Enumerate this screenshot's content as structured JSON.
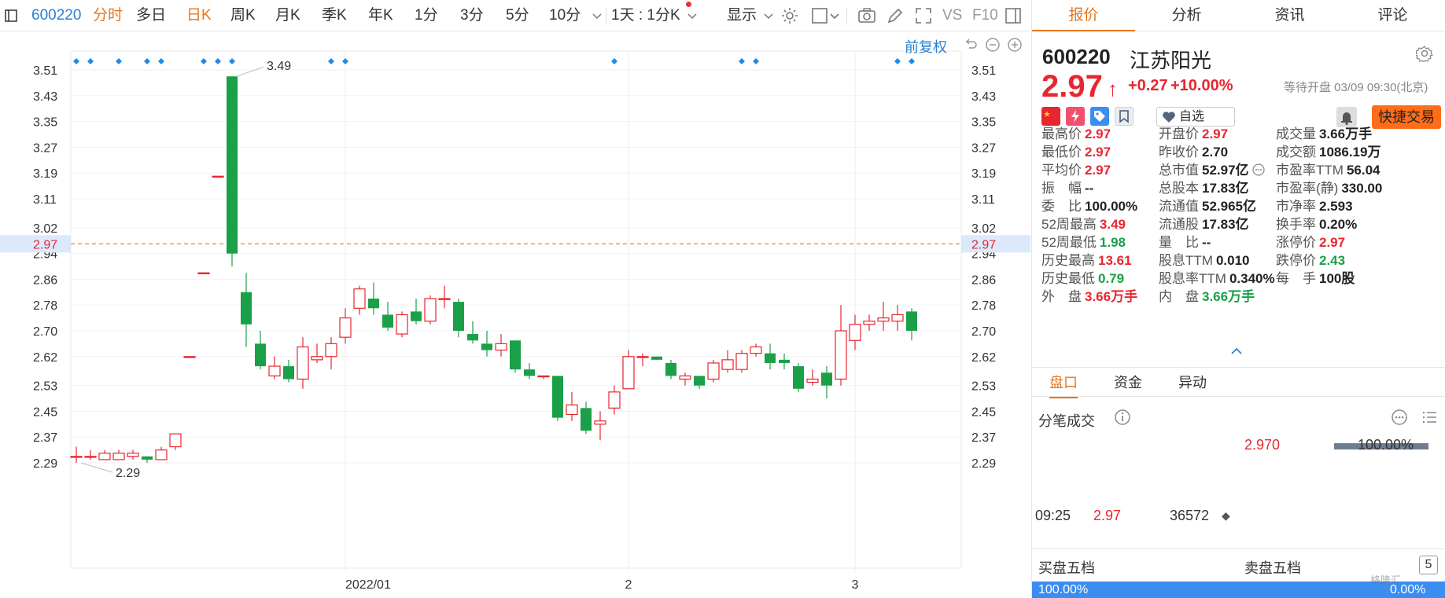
{
  "toolbar": {
    "code": "600220",
    "items": [
      "分时",
      "多日",
      "日K",
      "周K",
      "月K",
      "季K",
      "年K",
      "1分",
      "3分",
      "5分",
      "10分"
    ],
    "active": "日K",
    "highlight": "分时",
    "period_select": "1天 : 1分K",
    "display_label": "显示",
    "right_labels": [
      "VS",
      "F10"
    ]
  },
  "chart": {
    "fuquan_label": "前复权",
    "current_price_label": "2.97",
    "x_labels": [
      "2022/01",
      "2",
      "3"
    ],
    "annotations": {
      "high": "3.49",
      "low": "2.29"
    }
  },
  "chart_data": {
    "type": "candlestick",
    "ylim": [
      2.245,
      3.545
    ],
    "y_ticks": [
      "3.51",
      "3.43",
      "3.35",
      "3.27",
      "3.19",
      "3.11",
      "3.02",
      "2.94",
      "2.86",
      "2.78",
      "2.70",
      "2.62",
      "2.53",
      "2.45",
      "2.37",
      "2.29"
    ],
    "reference_price": 2.97,
    "candles": [
      {
        "o": 2.31,
        "h": 2.34,
        "l": 2.29,
        "c": 2.31
      },
      {
        "o": 2.31,
        "h": 2.33,
        "l": 2.3,
        "c": 2.31
      },
      {
        "o": 2.3,
        "h": 2.33,
        "l": 2.3,
        "c": 2.32
      },
      {
        "o": 2.3,
        "h": 2.33,
        "l": 2.3,
        "c": 2.32
      },
      {
        "o": 2.31,
        "h": 2.33,
        "l": 2.3,
        "c": 2.32
      },
      {
        "o": 2.31,
        "h": 2.31,
        "l": 2.29,
        "c": 2.3
      },
      {
        "o": 2.3,
        "h": 2.34,
        "l": 2.3,
        "c": 2.33
      },
      {
        "o": 2.34,
        "h": 2.38,
        "l": 2.33,
        "c": 2.38
      },
      {
        "o": 2.62,
        "h": 2.62,
        "l": 2.62,
        "c": 2.62
      },
      {
        "o": 2.88,
        "h": 2.88,
        "l": 2.88,
        "c": 2.88
      },
      {
        "o": 3.18,
        "h": 3.18,
        "l": 3.18,
        "c": 3.18
      },
      {
        "o": 3.49,
        "h": 3.49,
        "l": 2.9,
        "c": 2.94
      },
      {
        "o": 2.82,
        "h": 2.88,
        "l": 2.65,
        "c": 2.72
      },
      {
        "o": 2.66,
        "h": 2.7,
        "l": 2.58,
        "c": 2.59
      },
      {
        "o": 2.56,
        "h": 2.62,
        "l": 2.55,
        "c": 2.59
      },
      {
        "o": 2.59,
        "h": 2.61,
        "l": 2.54,
        "c": 2.55
      },
      {
        "o": 2.55,
        "h": 2.68,
        "l": 2.52,
        "c": 2.65
      },
      {
        "o": 2.61,
        "h": 2.66,
        "l": 2.6,
        "c": 2.62
      },
      {
        "o": 2.62,
        "h": 2.68,
        "l": 2.58,
        "c": 2.66
      },
      {
        "o": 2.68,
        "h": 2.77,
        "l": 2.66,
        "c": 2.74
      },
      {
        "o": 2.77,
        "h": 2.84,
        "l": 2.75,
        "c": 2.83
      },
      {
        "o": 2.8,
        "h": 2.85,
        "l": 2.75,
        "c": 2.77
      },
      {
        "o": 2.75,
        "h": 2.79,
        "l": 2.7,
        "c": 2.71
      },
      {
        "o": 2.69,
        "h": 2.76,
        "l": 2.68,
        "c": 2.75
      },
      {
        "o": 2.76,
        "h": 2.8,
        "l": 2.72,
        "c": 2.73
      },
      {
        "o": 2.73,
        "h": 2.81,
        "l": 2.72,
        "c": 2.8
      },
      {
        "o": 2.8,
        "h": 2.84,
        "l": 2.77,
        "c": 2.8
      },
      {
        "o": 2.79,
        "h": 2.8,
        "l": 2.68,
        "c": 2.7
      },
      {
        "o": 2.69,
        "h": 2.73,
        "l": 2.66,
        "c": 2.67
      },
      {
        "o": 2.66,
        "h": 2.7,
        "l": 2.62,
        "c": 2.64
      },
      {
        "o": 2.64,
        "h": 2.69,
        "l": 2.62,
        "c": 2.66
      },
      {
        "o": 2.67,
        "h": 2.67,
        "l": 2.57,
        "c": 2.58
      },
      {
        "o": 2.58,
        "h": 2.6,
        "l": 2.55,
        "c": 2.56
      },
      {
        "o": 2.56,
        "h": 2.56,
        "l": 2.55,
        "c": 2.56
      },
      {
        "o": 2.56,
        "h": 2.56,
        "l": 2.42,
        "c": 2.43
      },
      {
        "o": 2.44,
        "h": 2.51,
        "l": 2.42,
        "c": 2.47
      },
      {
        "o": 2.46,
        "h": 2.48,
        "l": 2.38,
        "c": 2.39
      },
      {
        "o": 2.41,
        "h": 2.45,
        "l": 2.36,
        "c": 2.42
      },
      {
        "o": 2.46,
        "h": 2.53,
        "l": 2.44,
        "c": 2.51
      },
      {
        "o": 2.52,
        "h": 2.64,
        "l": 2.52,
        "c": 2.62
      },
      {
        "o": 2.62,
        "h": 2.63,
        "l": 2.59,
        "c": 2.62
      },
      {
        "o": 2.62,
        "h": 2.62,
        "l": 2.61,
        "c": 2.61
      },
      {
        "o": 2.6,
        "h": 2.61,
        "l": 2.55,
        "c": 2.56
      },
      {
        "o": 2.55,
        "h": 2.57,
        "l": 2.53,
        "c": 2.56
      },
      {
        "o": 2.56,
        "h": 2.56,
        "l": 2.52,
        "c": 2.53
      },
      {
        "o": 2.55,
        "h": 2.61,
        "l": 2.54,
        "c": 2.6
      },
      {
        "o": 2.58,
        "h": 2.64,
        "l": 2.57,
        "c": 2.61
      },
      {
        "o": 2.58,
        "h": 2.64,
        "l": 2.57,
        "c": 2.63
      },
      {
        "o": 2.63,
        "h": 2.66,
        "l": 2.62,
        "c": 2.65
      },
      {
        "o": 2.63,
        "h": 2.66,
        "l": 2.58,
        "c": 2.6
      },
      {
        "o": 2.61,
        "h": 2.63,
        "l": 2.58,
        "c": 2.6
      },
      {
        "o": 2.59,
        "h": 2.6,
        "l": 2.51,
        "c": 2.52
      },
      {
        "o": 2.54,
        "h": 2.58,
        "l": 2.53,
        "c": 2.55
      },
      {
        "o": 2.57,
        "h": 2.59,
        "l": 2.49,
        "c": 2.53
      },
      {
        "o": 2.55,
        "h": 2.78,
        "l": 2.53,
        "c": 2.7
      },
      {
        "o": 2.67,
        "h": 2.75,
        "l": 2.64,
        "c": 2.72
      },
      {
        "o": 2.72,
        "h": 2.75,
        "l": 2.7,
        "c": 2.73
      },
      {
        "o": 2.73,
        "h": 2.79,
        "l": 2.7,
        "c": 2.74
      },
      {
        "o": 2.73,
        "h": 2.78,
        "l": 2.7,
        "c": 2.75
      },
      {
        "o": 2.76,
        "h": 2.77,
        "l": 2.67,
        "c": 2.7
      }
    ],
    "x_label_candle_index": [
      19,
      39,
      55
    ],
    "marker_candle_indices": [
      0,
      1,
      3,
      5,
      6,
      9,
      10,
      11,
      18,
      19,
      38,
      47,
      48,
      58,
      59
    ]
  },
  "quote": {
    "code": "600220",
    "name": "江苏阳光",
    "price": "2.97",
    "change": "+0.27",
    "change_pct": "+10.00%",
    "status": "等待开盘 03/09 09:30(北京)",
    "watch_label": "自选",
    "quick_trade_label": "快捷交易",
    "stats": [
      {
        "label": "最高价",
        "value": "2.97",
        "color": "up"
      },
      {
        "label": "开盘价",
        "value": "2.97",
        "color": "up"
      },
      {
        "label": "成交量",
        "value": "3.66万手",
        "color": ""
      },
      {
        "label": "最低价",
        "value": "2.97",
        "color": "up"
      },
      {
        "label": "昨收价",
        "value": "2.70",
        "color": ""
      },
      {
        "label": "成交额",
        "value": "1086.19万",
        "color": ""
      },
      {
        "label": "平均价",
        "value": "2.97",
        "color": "up"
      },
      {
        "label": "总市值",
        "value": "52.97亿",
        "color": ""
      },
      {
        "label": "市盈率TTM",
        "value": "56.04",
        "color": ""
      },
      {
        "label": "振　幅",
        "value": "--",
        "color": ""
      },
      {
        "label": "总股本",
        "value": "17.83亿",
        "color": ""
      },
      {
        "label": "市盈率(静)",
        "value": "330.00",
        "color": ""
      },
      {
        "label": "委　比",
        "value": "100.00%",
        "color": ""
      },
      {
        "label": "流通值",
        "value": "52.965亿",
        "color": ""
      },
      {
        "label": "市净率",
        "value": "2.593",
        "color": ""
      },
      {
        "label": "52周最高",
        "value": "3.49",
        "color": "up"
      },
      {
        "label": "流通股",
        "value": "17.83亿",
        "color": ""
      },
      {
        "label": "换手率",
        "value": "0.20%",
        "color": ""
      },
      {
        "label": "52周最低",
        "value": "1.98",
        "color": "dn"
      },
      {
        "label": "量　比",
        "value": "--",
        "color": ""
      },
      {
        "label": "涨停价",
        "value": "2.97",
        "color": "up"
      },
      {
        "label": "历史最高",
        "value": "13.61",
        "color": "up"
      },
      {
        "label": "股息TTM",
        "value": "0.010",
        "color": ""
      },
      {
        "label": "跌停价",
        "value": "2.43",
        "color": "dn"
      },
      {
        "label": "历史最低",
        "value": "0.79",
        "color": "dn"
      },
      {
        "label": "股息率TTM",
        "value": "0.340%",
        "color": ""
      },
      {
        "label": "每　手",
        "value": "100股",
        "color": ""
      },
      {
        "label": "外　盘",
        "value": "3.66万手",
        "color": "up"
      },
      {
        "label": "内　盘",
        "value": "3.66万手",
        "color": "dn"
      }
    ]
  },
  "tabs": [
    "报价",
    "分析",
    "资讯",
    "评论"
  ],
  "sub_tabs": [
    "盘口",
    "资金",
    "异动"
  ],
  "ticks": {
    "title": "分笔成交",
    "bar_price": "2.970",
    "bar_pct": "100.00%",
    "bar_fraction": 1.0,
    "time": "09:25",
    "price": "2.97",
    "volume": "36572",
    "marker": "◆"
  },
  "depth": {
    "buy_label": "买盘五档",
    "sell_label": "卖盘五档",
    "count_btn": "5",
    "buy_pct": "100.00%",
    "sell_pct": "0.00%"
  },
  "watermark": "格隆汇",
  "colors": {
    "up": "#e8262f",
    "down": "#1aa048",
    "accent": "#e8751a",
    "link": "#2a7fd4",
    "marker": "#1d8be8",
    "ref_line": "#f09a3e"
  }
}
